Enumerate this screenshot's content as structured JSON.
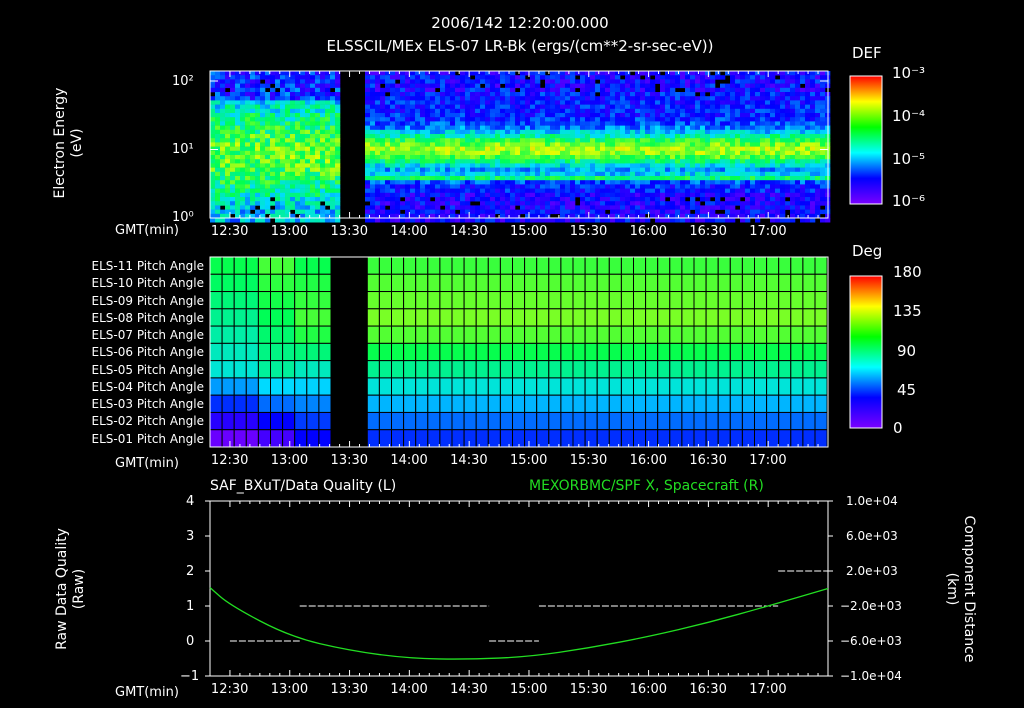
{
  "header": {
    "datetime": "2006/142 12:20:00.000",
    "subtitle": "ELSSCIL/MEx ELS-07 LR-Bk  (ergs/(cm**2-sr-sec-eV))"
  },
  "time_axis": {
    "label": "GMT(min)",
    "ticks": [
      "12:30",
      "13:00",
      "13:30",
      "14:00",
      "14:30",
      "15:00",
      "15:30",
      "16:00",
      "16:30",
      "17:00"
    ]
  },
  "colors": {
    "background": "#000000",
    "foreground": "#ffffff",
    "spacecraft_line": "#22dd22",
    "colorbar": [
      "#7a00ff",
      "#0000ff",
      "#00ffff",
      "#00ff00",
      "#ffff00",
      "#ff0000"
    ]
  },
  "panel1": {
    "ylabel_line1": "Electron Energy",
    "ylabel_line2": "(eV)",
    "yticks": [
      "10²",
      "10¹",
      "10⁰"
    ],
    "colorbar_title": "DEF",
    "colorbar_ticks": [
      "10⁻³",
      "10⁻⁴",
      "10⁻⁵",
      "10⁻⁶"
    ]
  },
  "panel2": {
    "rows": [
      "ELS-11 Pitch Angle",
      "ELS-10 Pitch Angle",
      "ELS-09 Pitch Angle",
      "ELS-08 Pitch Angle",
      "ELS-07 Pitch Angle",
      "ELS-06 Pitch Angle",
      "ELS-05 Pitch Angle",
      "ELS-04 Pitch Angle",
      "ELS-03 Pitch Angle",
      "ELS-02 Pitch Angle",
      "ELS-01 Pitch Angle"
    ],
    "colorbar_title": "Deg",
    "colorbar_ticks": [
      "180",
      "135",
      "90",
      "45",
      "0"
    ]
  },
  "panel3": {
    "left_title": "SAF_BXuT/Data Quality (L)",
    "right_title": "MEXORBMC/SPF X, Spacecraft (R)",
    "ylabel_line1": "Raw Data Quality",
    "ylabel_line2": "(Raw)",
    "yticks": [
      "4",
      "3",
      "2",
      "1",
      "0",
      "−1"
    ],
    "rlabel_line1": "Component Distance",
    "rlabel_line2": "(km)",
    "rticks": [
      "1.0e+04",
      "6.0e+03",
      "2.0e+03",
      "−2.0e+03",
      "−6.0e+03",
      "−1.0e+04"
    ]
  },
  "chart_data": [
    {
      "type": "heatmap",
      "title": "ELSSCIL/MEx ELS-07 LR-Bk  (ergs/(cm**2-sr-sec-eV))",
      "xlabel": "GMT(min)",
      "ylabel": "Electron Energy (eV)",
      "x_range": [
        "12:20",
        "17:30"
      ],
      "y_range": [
        1,
        150
      ],
      "y_scale": "log",
      "colorbar_label": "DEF",
      "colorbar_range": [
        1e-06,
        0.001
      ],
      "colorbar_scale": "log",
      "data_gap": [
        "13:25",
        "13:36"
      ]
    },
    {
      "type": "heatmap",
      "xlabel": "GMT(min)",
      "categories": [
        "ELS-11",
        "ELS-10",
        "ELS-09",
        "ELS-08",
        "ELS-07",
        "ELS-06",
        "ELS-05",
        "ELS-04",
        "ELS-03",
        "ELS-02",
        "ELS-01"
      ],
      "colorbar_label": "Deg",
      "colorbar_range": [
        0,
        180
      ],
      "approx_pitch_deg_after_gap": [
        108,
        112,
        115,
        118,
        112,
        100,
        88,
        75,
        62,
        50,
        40
      ],
      "data_gap": [
        "13:25",
        "13:36"
      ]
    },
    {
      "type": "line",
      "title": "SAF_BXuT/Data Quality (L)",
      "xlabel": "GMT(min)",
      "ylabel": "Raw Data Quality (Raw)",
      "ylim": [
        -1,
        4
      ],
      "series": [
        {
          "name": "SAF_BXuT/Data Quality",
          "axis": "left",
          "style": "dashed",
          "x": [
            "12:30",
            "13:05",
            "13:05",
            "14:40",
            "14:40",
            "15:05",
            "15:05",
            "17:05",
            "17:05",
            "17:30"
          ],
          "y": [
            0,
            0,
            1,
            1,
            0,
            0,
            1,
            1,
            2,
            2
          ]
        },
        {
          "name": "MEXORBMC/SPF X, Spacecraft",
          "axis": "right",
          "x": [
            "12:20",
            "12:30",
            "13:00",
            "13:30",
            "14:00",
            "14:30",
            "15:00",
            "15:30",
            "16:00",
            "16:30",
            "17:00",
            "17:30"
          ],
          "y": [
            100,
            -1900,
            -5500,
            -7100,
            -8000,
            -8100,
            -7800,
            -6800,
            -5500,
            -3900,
            -2000,
            0
          ]
        }
      ],
      "right_ylabel": "Component Distance (km)",
      "right_ylim": [
        -10000,
        10000
      ]
    }
  ]
}
